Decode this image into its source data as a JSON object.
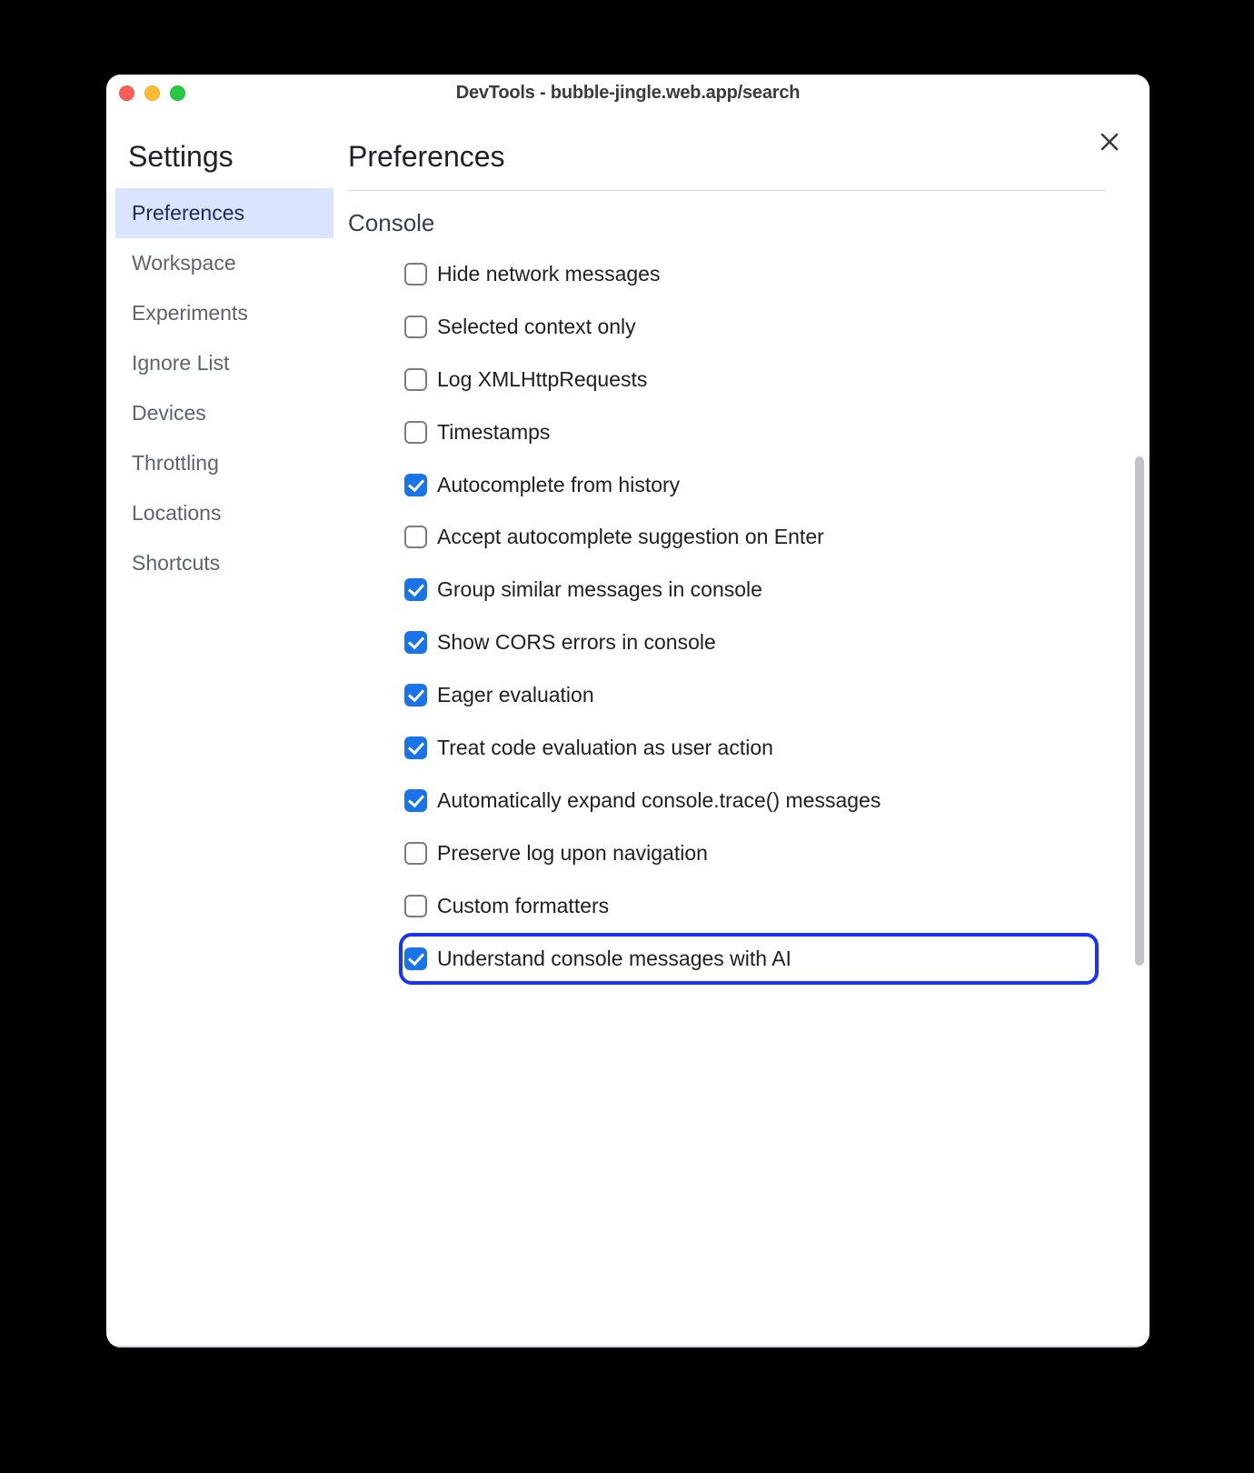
{
  "window": {
    "title": "DevTools - bubble-jingle.web.app/search"
  },
  "sidebar": {
    "title": "Settings",
    "items": [
      {
        "label": "Preferences",
        "active": true
      },
      {
        "label": "Workspace",
        "active": false
      },
      {
        "label": "Experiments",
        "active": false
      },
      {
        "label": "Ignore List",
        "active": false
      },
      {
        "label": "Devices",
        "active": false
      },
      {
        "label": "Throttling",
        "active": false
      },
      {
        "label": "Locations",
        "active": false
      },
      {
        "label": "Shortcuts",
        "active": false
      }
    ]
  },
  "page": {
    "title": "Preferences",
    "section_title": "Console",
    "options": [
      {
        "label": "Hide network messages",
        "checked": false,
        "highlighted": false
      },
      {
        "label": "Selected context only",
        "checked": false,
        "highlighted": false
      },
      {
        "label": "Log XMLHttpRequests",
        "checked": false,
        "highlighted": false
      },
      {
        "label": "Timestamps",
        "checked": false,
        "highlighted": false
      },
      {
        "label": "Autocomplete from history",
        "checked": true,
        "highlighted": false
      },
      {
        "label": "Accept autocomplete suggestion on Enter",
        "checked": false,
        "highlighted": false
      },
      {
        "label": "Group similar messages in console",
        "checked": true,
        "highlighted": false
      },
      {
        "label": "Show CORS errors in console",
        "checked": true,
        "highlighted": false
      },
      {
        "label": "Eager evaluation",
        "checked": true,
        "highlighted": false
      },
      {
        "label": "Treat code evaluation as user action",
        "checked": true,
        "highlighted": false
      },
      {
        "label": "Automatically expand console.trace() messages",
        "checked": true,
        "highlighted": false
      },
      {
        "label": "Preserve log upon navigation",
        "checked": false,
        "highlighted": false
      },
      {
        "label": "Custom formatters",
        "checked": false,
        "highlighted": false
      },
      {
        "label": "Understand console messages with AI",
        "checked": true,
        "highlighted": true
      }
    ]
  }
}
